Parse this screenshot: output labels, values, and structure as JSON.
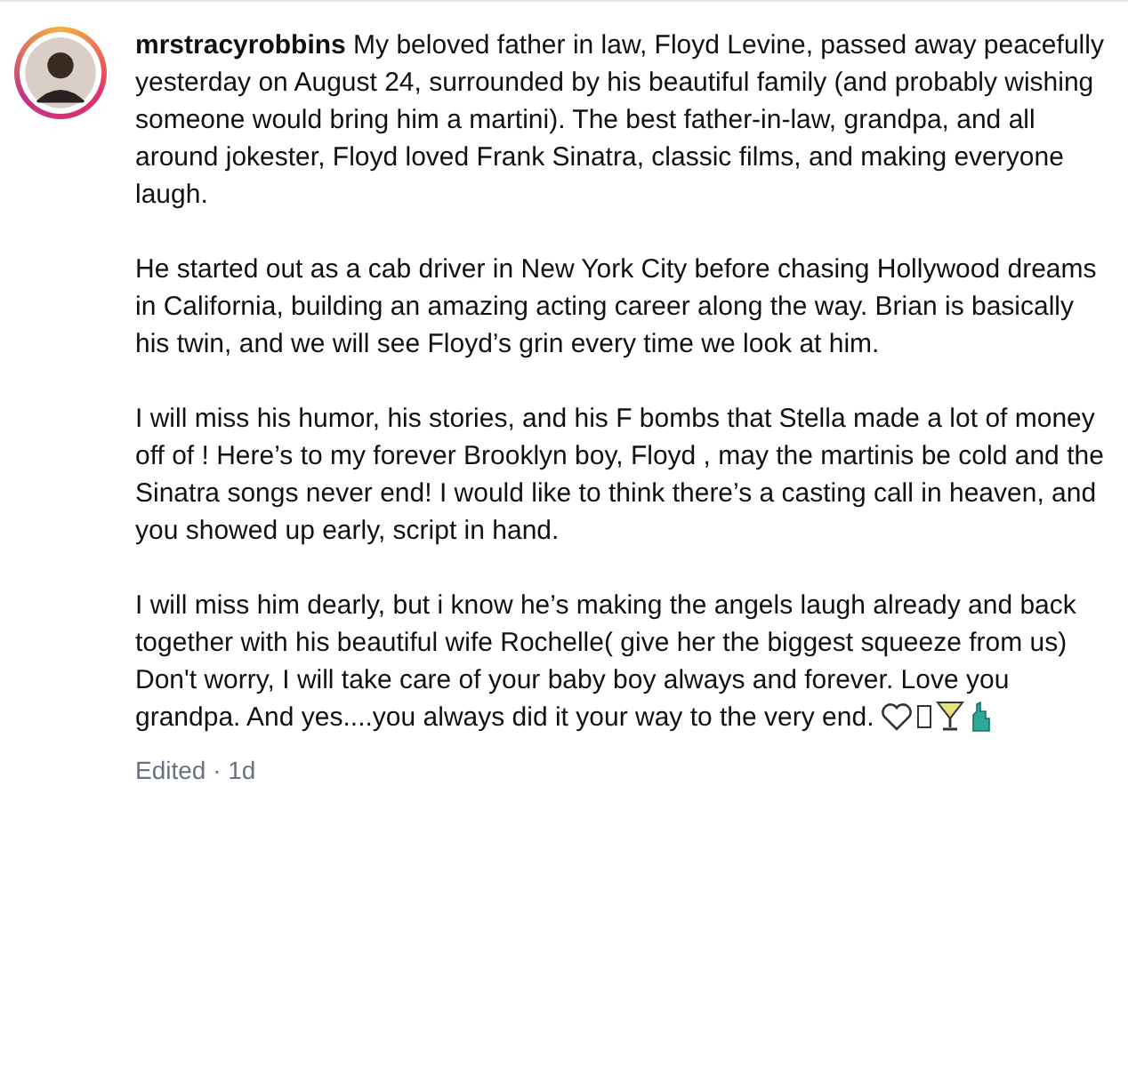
{
  "caption": {
    "paragraphs": [
      "**mrstracyrobbins** My beloved father in law, Floyd Levine, passed away peacefully yesterday on August 24, surrounded by his beautiful family (and probably wishing someone would bring him a martini). The best father-in-law, grandpa, and all around jokester, Floyd loved Frank Sinatra, classic films, and making everyone laugh.",
      "He started out as a cab driver in New York City before chasing Hollywood dreams in California, building an amazing acting career along the way. Brian is basically his twin, and we will see Floyd’s grin every time we look at him.",
      "I will miss his humor, his stories, and his F bombs that Stella made a lot of money off of ! Here’s to my forever Brooklyn boy, Floyd , may the martinis be cold and the Sinatra songs never end! I would like to think there’s a casting call in heaven, and you showed up early, script in hand.",
      "I will miss him dearly, but i know he’s making the angels laugh already and back together with his beautiful wife Rochelle( give her the biggest squeeze from us) Don't worry, I will take care of your baby boy always and forever. Love you grandpa. And yes....you always did it your way to the very end."
    ],
    "meta": "Edited · 1d"
  }
}
